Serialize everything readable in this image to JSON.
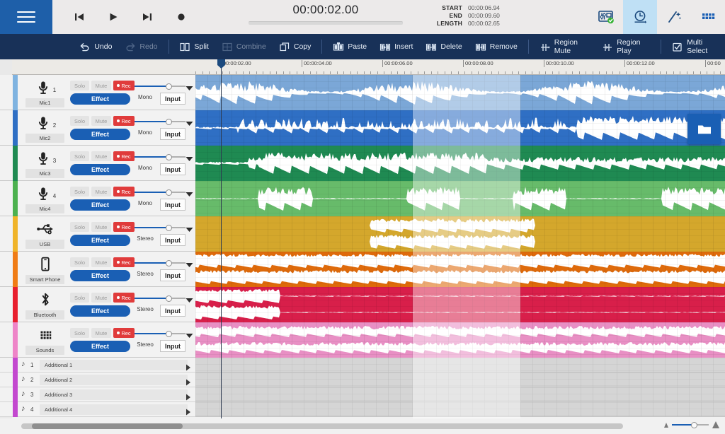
{
  "topbar": {
    "menu_icon": "hamburger-icon",
    "transport": [
      {
        "name": "skip-to-start-button",
        "icon": "skip-back-icon"
      },
      {
        "name": "play-button",
        "icon": "play-icon"
      },
      {
        "name": "skip-to-end-button",
        "icon": "skip-forward-icon"
      },
      {
        "name": "record-button",
        "icon": "record-icon"
      }
    ],
    "current_time": "00:00:02.00",
    "info": [
      {
        "label": "START",
        "value": "00:00:06.94"
      },
      {
        "label": "END",
        "value": "00:00:09.60"
      },
      {
        "label": "LENGTH",
        "value": "00:00:02.65"
      }
    ],
    "icons": [
      {
        "name": "mixer-settings-icon",
        "active": false
      },
      {
        "name": "timer-clock-icon",
        "active": true
      },
      {
        "name": "effects-wand-icon",
        "active": false
      },
      {
        "name": "grid-apps-icon",
        "active": false
      }
    ]
  },
  "toolbar": {
    "items": [
      {
        "label": "Undo",
        "icon": "undo-icon",
        "enabled": true
      },
      {
        "label": "Redo",
        "icon": "redo-icon",
        "enabled": false
      },
      {
        "sep": true
      },
      {
        "label": "Split",
        "icon": "split-icon",
        "enabled": true
      },
      {
        "label": "Combine",
        "icon": "combine-icon",
        "enabled": false
      },
      {
        "label": "Copy",
        "icon": "copy-icon",
        "enabled": true
      },
      {
        "sep": true
      },
      {
        "label": "Paste",
        "icon": "paste-icon",
        "enabled": true
      },
      {
        "label": "Insert",
        "icon": "insert-icon",
        "enabled": true
      },
      {
        "label": "Delete",
        "icon": "delete-icon",
        "enabled": true
      },
      {
        "label": "Remove",
        "icon": "remove-icon",
        "enabled": true
      },
      {
        "sep": true
      },
      {
        "label": "Region Mute",
        "icon": "region-mute-icon",
        "enabled": true
      },
      {
        "label": "Region Play",
        "icon": "region-play-icon",
        "enabled": true
      },
      {
        "sep": true
      },
      {
        "label": "Multi Select",
        "icon": "multi-select-icon",
        "enabled": true
      }
    ]
  },
  "ruler": {
    "labels": [
      "00:00:02.00",
      "00:00:04.00",
      "00:00:06.00",
      "00:00:08.00",
      "00:00:10.00",
      "00:00:12.00",
      "00:00"
    ],
    "positions": [
      36,
      150,
      264,
      378,
      492,
      606,
      720
    ]
  },
  "tracks": {
    "common": {
      "solo_label": "Solo",
      "mute_label": "Mute",
      "rec_label": "Rec",
      "effect_label": "Effect",
      "input_label": "Input"
    },
    "items": [
      {
        "num": "1",
        "name": "Mic1",
        "icon": "microphone-icon",
        "mode": "Mono",
        "color": "#7ba7d7",
        "strip": "#7fb3e0",
        "wave_color": "#ffffff",
        "density": "speech-dense"
      },
      {
        "num": "2",
        "name": "Mic2",
        "icon": "microphone-icon",
        "mode": "Mono",
        "color": "#2f6fc4",
        "strip": "#2f6fc4",
        "wave_color": "#ffffff",
        "density": "speech-sparse"
      },
      {
        "num": "3",
        "name": "Mic3",
        "icon": "microphone-icon",
        "mode": "Mono",
        "color": "#1f8a52",
        "strip": "#1f8a52",
        "wave_color": "#ffffff",
        "density": "speech-mid"
      },
      {
        "num": "4",
        "name": "Mic4",
        "icon": "microphone-icon",
        "mode": "Mono",
        "color": "#67bb6a",
        "strip": "#4cb14f",
        "wave_color": "#ffffff",
        "density": "bursts"
      },
      {
        "num": "",
        "name": "USB",
        "icon": "usb-icon",
        "mode": "Stereo",
        "color": "#d4a72c",
        "strip": "#f0b429",
        "wave_color": "#ffffff",
        "density": "mid-band"
      },
      {
        "num": "",
        "name": "Smart Phone",
        "icon": "smartphone-icon",
        "mode": "Stereo",
        "color": "#de6a0b",
        "strip": "#f07c15",
        "wave_color": "#ffffff",
        "density": "stereo-full"
      },
      {
        "num": "",
        "name": "Bluetooth",
        "icon": "bluetooth-icon",
        "mode": "Stereo",
        "color": "#d81f4a",
        "strip": "#e81f2e",
        "wave_color": "#ffffff",
        "density": "left-blob"
      },
      {
        "num": "",
        "name": "Sounds",
        "icon": "sound-grid-icon",
        "mode": "Stereo",
        "color": "#e88fc4",
        "strip": "#ee85c8",
        "wave_color": "#ffffff",
        "density": "thin-stereo"
      }
    ],
    "additional": [
      {
        "num": "1",
        "label": "Additional 1",
        "icon": "music-note-icon"
      },
      {
        "num": "2",
        "label": "Additional 2",
        "icon": "music-note-icon"
      },
      {
        "num": "3",
        "label": "Additional 3",
        "icon": "music-note-icon"
      },
      {
        "num": "4",
        "label": "Additional 4",
        "icon": "music-note-icon"
      }
    ]
  },
  "overlay": {
    "folder_button_icon": "folder-icon",
    "playhead_position_label": "00:00:02.00"
  },
  "bottom": {
    "zoom_out_icon": "zoom-small-icon",
    "zoom_in_icon": "zoom-large-icon",
    "scrollbar": "horizontal-scrollbar"
  }
}
